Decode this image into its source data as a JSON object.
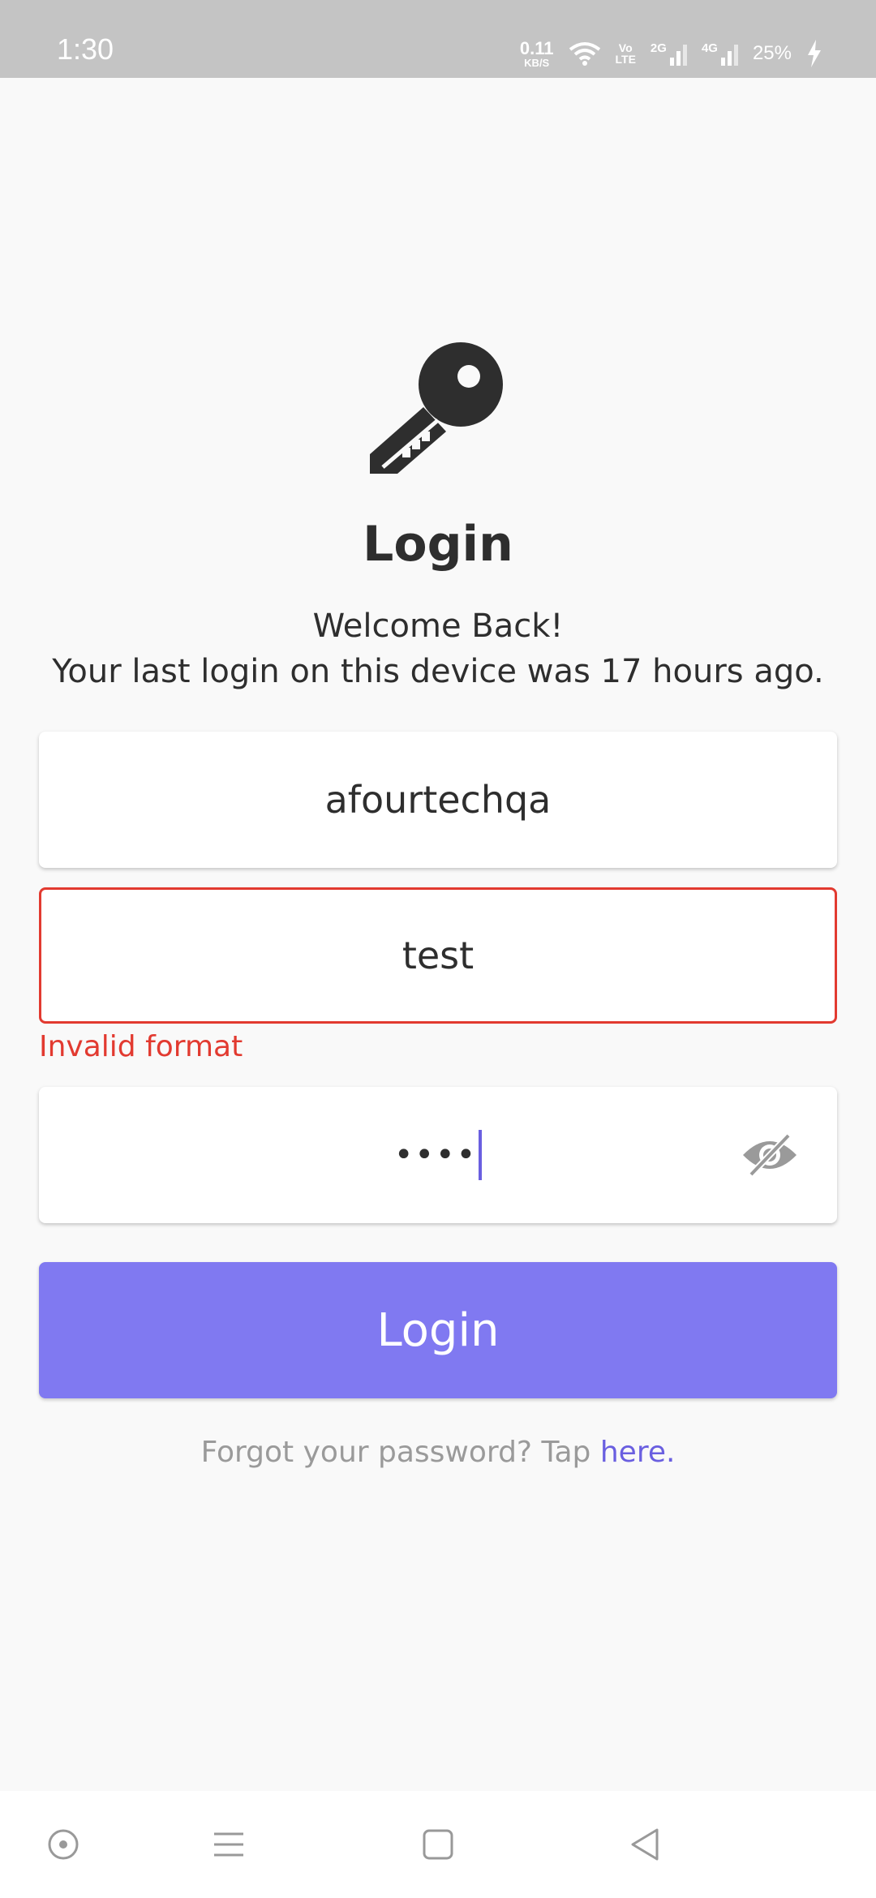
{
  "status_bar": {
    "time": "1:30",
    "net_speed_value": "0.11",
    "net_speed_unit": "KB/S",
    "volte_top": "Vo",
    "volte_bottom": "LTE",
    "signal1_label": "2G",
    "signal2_label": "4G",
    "battery": "25%",
    "icons": [
      "wifi-icon",
      "volte-icon",
      "signal-icon",
      "charging-icon"
    ]
  },
  "login": {
    "icon": "key-icon",
    "title": "Login",
    "welcome_line1": "Welcome Back!",
    "welcome_line2": "Your last login on this device was 17 hours ago.",
    "username_value": "afourtechqa",
    "email_value": "test",
    "email_error": "Invalid format",
    "password_value": "••••",
    "password_toggle_icon": "eye-off-icon",
    "button_label": "Login",
    "forgot_text": "Forgot your password? Tap ",
    "forgot_link": "here."
  },
  "nav_bar": {
    "icons": [
      "circle-dot-icon",
      "menu-icon",
      "square-icon",
      "back-triangle-icon"
    ]
  },
  "colors": {
    "accent": "#8079f1",
    "error": "#e23a30",
    "link": "#6a5fe0",
    "status_bar_bg": "#c4c4c4"
  }
}
